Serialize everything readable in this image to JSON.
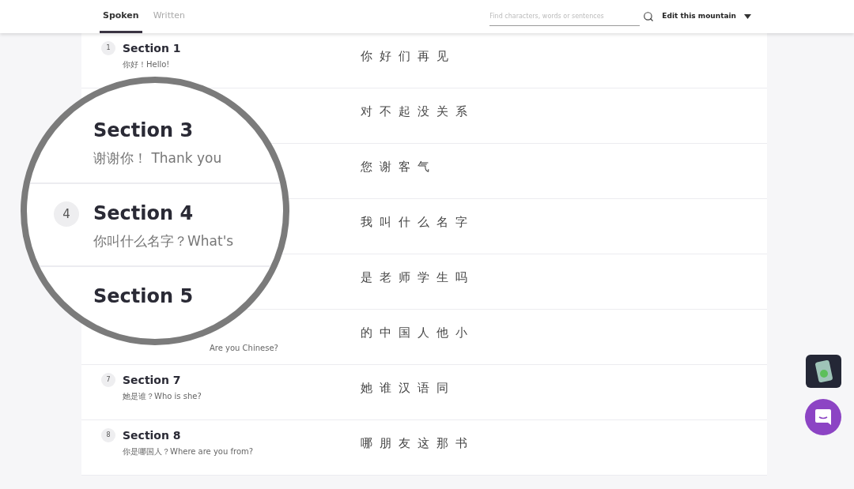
{
  "tabs": [
    {
      "label": "Spoken",
      "selected": true
    },
    {
      "label": "Written",
      "selected": false
    }
  ],
  "search": {
    "placeholder": "Find characters, words or sentences"
  },
  "edit_menu": {
    "label": "Edit this mountain"
  },
  "sections": [
    {
      "number": "1",
      "title": "Section 1",
      "subtitle": "你好！Hello!",
      "characters": "你好们再见"
    },
    {
      "characters": "对不起没关系"
    },
    {
      "characters": "您谢客气"
    },
    {
      "characters": "我叫什么名字"
    },
    {
      "characters": "是老师学生吗"
    },
    {
      "subtitle": "Are you Chinese?",
      "characters": "的中国人他小"
    },
    {
      "number": "7",
      "title": "Section 7",
      "subtitle": "她是谁？Who is she?",
      "characters": "她谁汉语同"
    },
    {
      "number": "8",
      "title": "Section 8",
      "subtitle": "你是哪国人？Where are you from?",
      "characters": "哪朋友这那书"
    }
  ],
  "magnifier": {
    "rows": [
      {
        "title": "Section 3",
        "subtitle": "谢谢你！ Thank you"
      },
      {
        "number": "4",
        "title": "Section 4",
        "subtitle": "你叫什么名字？What's"
      },
      {
        "title": "Section 5"
      }
    ]
  }
}
